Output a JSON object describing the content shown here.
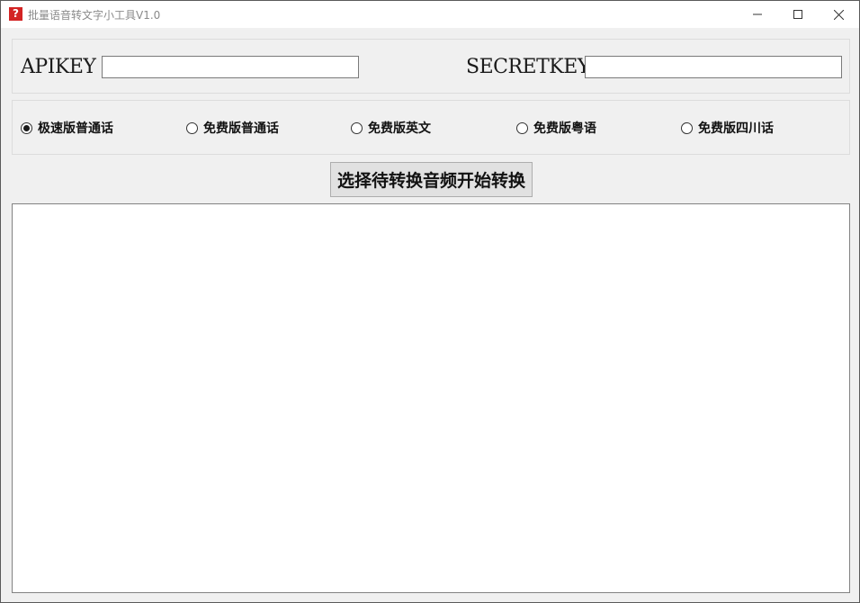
{
  "window": {
    "title": "批量语音转文字小工具V1.0",
    "icon": "question-icon",
    "icon_glyph": "?",
    "controls": [
      "minimize-icon",
      "maximize-icon",
      "close-icon"
    ]
  },
  "keys": {
    "api_label": "APIKEY",
    "api_value": "",
    "secret_label": "SECRETKEY",
    "secret_value": ""
  },
  "modes": {
    "selected_index": 0,
    "options": [
      {
        "label": "极速版普通话",
        "checked": true
      },
      {
        "label": "免费版普通话",
        "checked": false
      },
      {
        "label": "免费版英文",
        "checked": false
      },
      {
        "label": "免费版粤语",
        "checked": false
      },
      {
        "label": "免费版四川话",
        "checked": false
      }
    ]
  },
  "actions": {
    "convert_label": "选择待转换音频开始转换"
  },
  "output": {
    "text": ""
  },
  "colors": {
    "background": "#f0f0f0",
    "app_icon": "#d32424",
    "title_text": "#8a8a8a"
  }
}
